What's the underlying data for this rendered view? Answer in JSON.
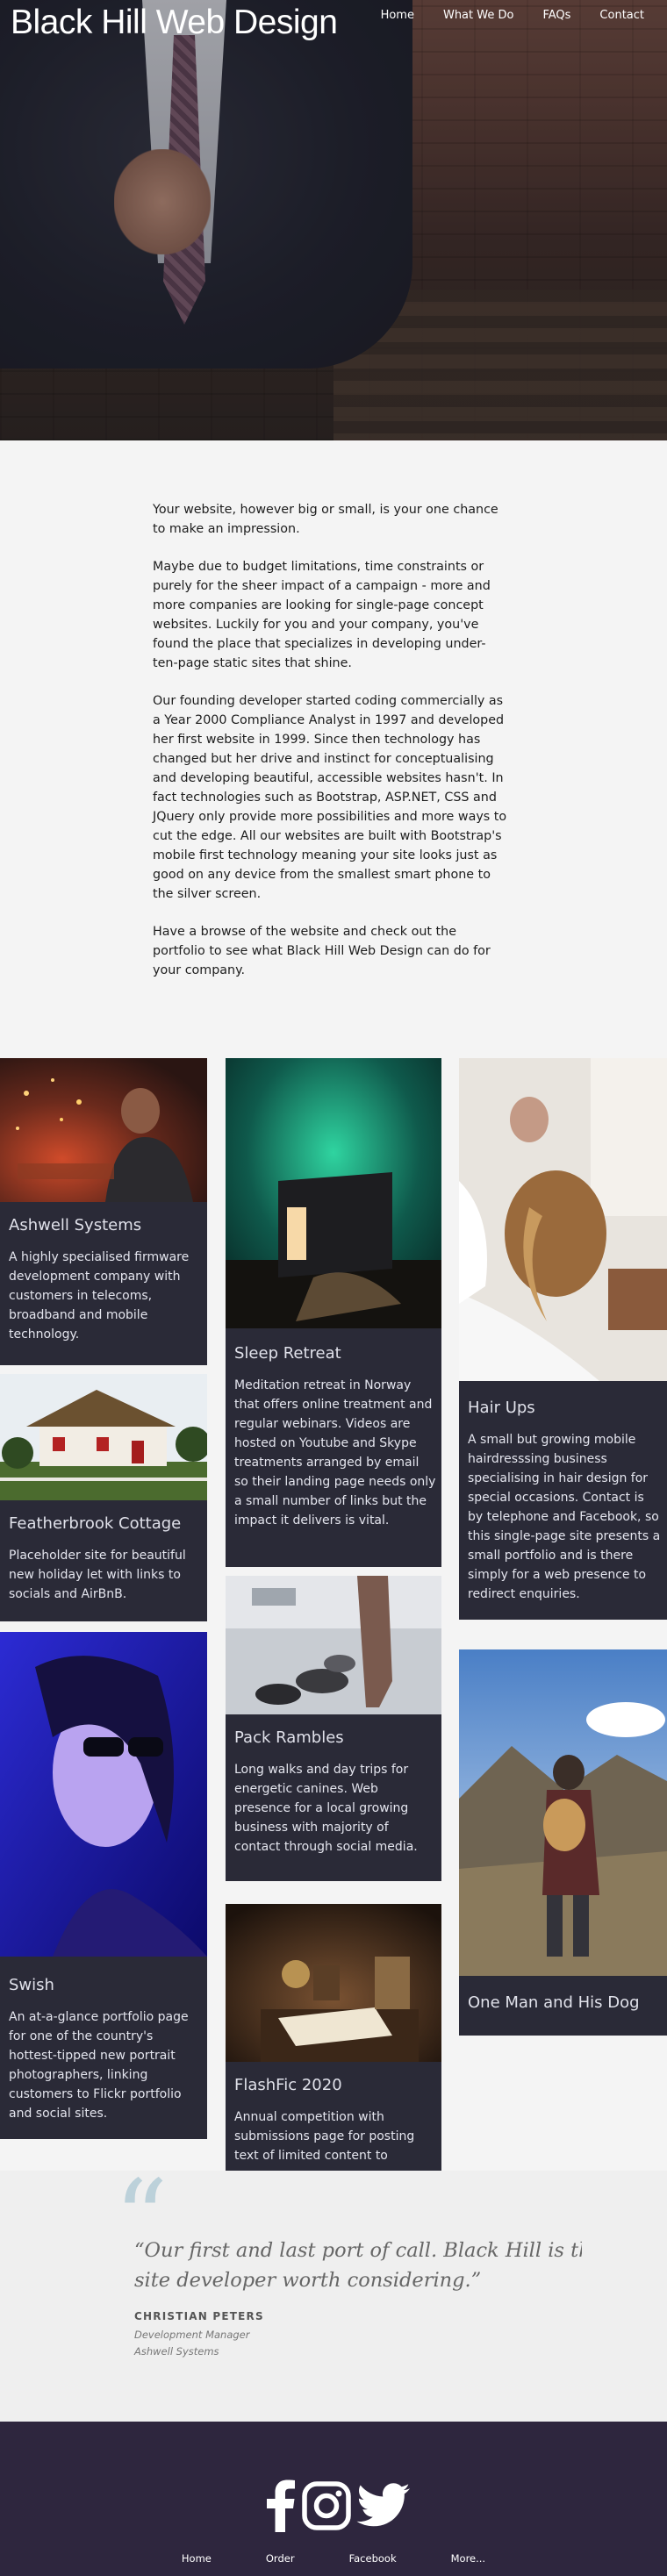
{
  "header": {
    "brand": "Black Hill Web Design",
    "nav": [
      "Home",
      "What We Do",
      "FAQs",
      "Contact"
    ]
  },
  "intro": {
    "paragraphs": [
      "Your website, however big or small, is your one chance to make an impression.",
      "Maybe due to budget limitations, time constraints or purely for the sheer impact of a campaign - more and more companies are looking for single-page concept websites. Luckily for you and your company, you've found the place that specializes in developing under-ten-page static sites that shine.",
      "Our founding developer started coding commercially as a Year 2000 Compliance Analyst in 1997 and developed her first website in 1999. Since then technology has changed but her drive and instinct for conceptualising and developing beautiful, accessible websites hasn't. In fact technologies such as Bootstrap, ASP.NET, CSS and JQuery only provide more possibilities and more ways to cut the edge. All our websites are built with Bootstrap's mobile first technology meaning your site looks just as good on any device from the smallest smart phone to the silver screen.",
      "Have a browse of the website and check out the portfolio to see what Black Hill Web Design can do for your company."
    ]
  },
  "portfolio": [
    {
      "title": "Ashwell Systems",
      "text": "A highly specialised firmware development company with customers in telecoms, broadband and mobile technology."
    },
    {
      "title": "Sleep Retreat",
      "text": "Meditation retreat in Norway that offers online treatment and regular webinars. Videos are hosted on Youtube and Skype treatments arranged by email so their landing page needs only a small number of links but the impact it delivers is vital."
    },
    {
      "title": "Hair Ups",
      "text": "A small but growing mobile hairdresssing business specialising in hair design for special occasions. Contact is by telephone and Facebook, so this single-page site presents a small portfolio and is there simply for a web presence to redirect enquiries."
    },
    {
      "title": "Featherbrook Cottage",
      "text": "Placeholder site for beautiful new holiday let with links to socials and AirBnB."
    },
    {
      "title": "Pack Rambles",
      "text": "Long walks and day trips for energetic canines. Web presence for a local growing business with majority of contact through social media."
    },
    {
      "title": "Swish",
      "text": "An at-a-glance portfolio page for one of the country's hottest-tipped new portrait photographers, linking customers to Flickr portfolio and social sites."
    },
    {
      "title": "One Man and His Dog",
      "text": ""
    },
    {
      "title": "FlashFic 2020",
      "text": "Annual competition with submissions page for posting text of limited content to"
    }
  ],
  "testimonial": {
    "quote": "“Our first and last port of call. Black Hill is the only site developer worth considering.”",
    "quote_line1": "“Our first and last port of call. Black Hill is the o",
    "quote_line2": "site developer worth considering.”",
    "name": "CHRISTIAN PETERS",
    "role": "Development Manager",
    "company": "Ashwell Systems"
  },
  "footer": {
    "social_icons": [
      "facebook-icon",
      "instagram-icon",
      "twitter-icon"
    ],
    "nav": [
      "Home",
      "Order",
      "Facebook",
      "More..."
    ]
  },
  "colors": {
    "card_bg": "#2a2a37",
    "footer_bg": "#2e263e",
    "page_bg": "#f4f4f4",
    "quote_mark": "#bcd1da"
  }
}
